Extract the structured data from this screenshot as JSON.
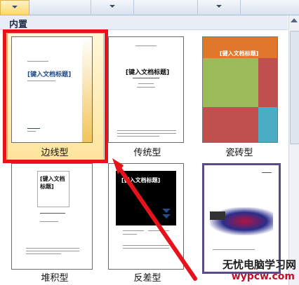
{
  "section": {
    "title": "内置"
  },
  "templates": [
    {
      "label": "边线型",
      "title": "[键入文档标题]"
    },
    {
      "label": "传统型",
      "title": "[键入文档标题]"
    },
    {
      "label": "瓷砖型",
      "title": "[键入文档标题]"
    },
    {
      "label": "堆积型",
      "title": "[键入文档标题]"
    },
    {
      "label": "反差型",
      "title": "[键入文档标题]"
    },
    {
      "label": "",
      "title": ""
    }
  ],
  "watermark": {
    "line1": "无忧电脑学习网",
    "line2": "wypcw.com"
  },
  "colors": {
    "selection": "#ffe39b",
    "highlight_frame": "#e8121a",
    "arrow": "#e8121a"
  }
}
